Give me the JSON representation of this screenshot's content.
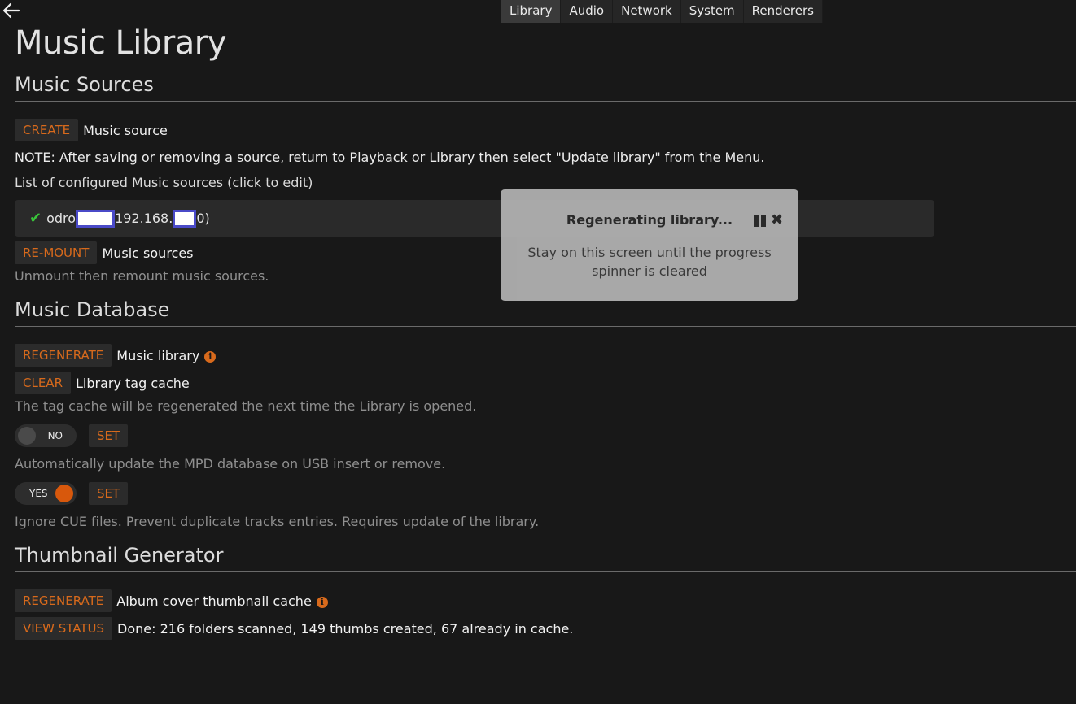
{
  "nav": {
    "back_icon": "arrow-left-icon",
    "tabs": [
      {
        "label": "Library",
        "active": true
      },
      {
        "label": "Audio",
        "active": false
      },
      {
        "label": "Network",
        "active": false
      },
      {
        "label": "System",
        "active": false
      },
      {
        "label": "Renderers",
        "active": false
      }
    ]
  },
  "page_title": "Music Library",
  "music_sources": {
    "heading": "Music Sources",
    "create_button": "CREATE",
    "create_label": "Music source",
    "note": "NOTE: After saving or removing a source, return to Playback or Library then select \"Update library\" from the Menu.",
    "list_label": "List of configured Music sources (click to edit)",
    "source": {
      "status_icon": "checkmark-icon",
      "name_prefix": "odro",
      "address_prefix": "192.168.",
      "suffix": "0)"
    },
    "remount_button": "RE-MOUNT",
    "remount_label": "Music sources",
    "remount_description": "Unmount then remount music sources."
  },
  "music_database": {
    "heading": "Music Database",
    "regenerate_button": "REGENERATE",
    "regenerate_label": "Music library",
    "clear_button": "CLEAR",
    "clear_label": "Library tag cache",
    "clear_description": "The tag cache will be regenerated the next time the Library is opened.",
    "usb_toggle": {
      "state": "NO",
      "on": false
    },
    "usb_set_button": "SET",
    "usb_description": "Automatically update the MPD database on USB insert or remove.",
    "cue_toggle": {
      "state": "YES",
      "on": true
    },
    "cue_set_button": "SET",
    "cue_description": "Ignore CUE files. Prevent duplicate tracks entries. Requires update of the library."
  },
  "thumbnail_generator": {
    "heading": "Thumbnail Generator",
    "regenerate_button": "REGENERATE",
    "regenerate_label": "Album cover thumbnail cache",
    "status_button": "VIEW STATUS",
    "status_text": "Done: 216 folders scanned, 149 thumbs created, 67 already in cache."
  },
  "info_icon_glyph": "i",
  "modal": {
    "title": "Regenerating library...",
    "message": "Stay on this screen until the progress spinner is cleared",
    "close_glyph": "✖"
  },
  "colors": {
    "background": "#181818",
    "accent": "#d86a1c",
    "toggle_on": "#d8580c",
    "check": "#39c43a",
    "modal_bg": "#b3b3b3"
  }
}
